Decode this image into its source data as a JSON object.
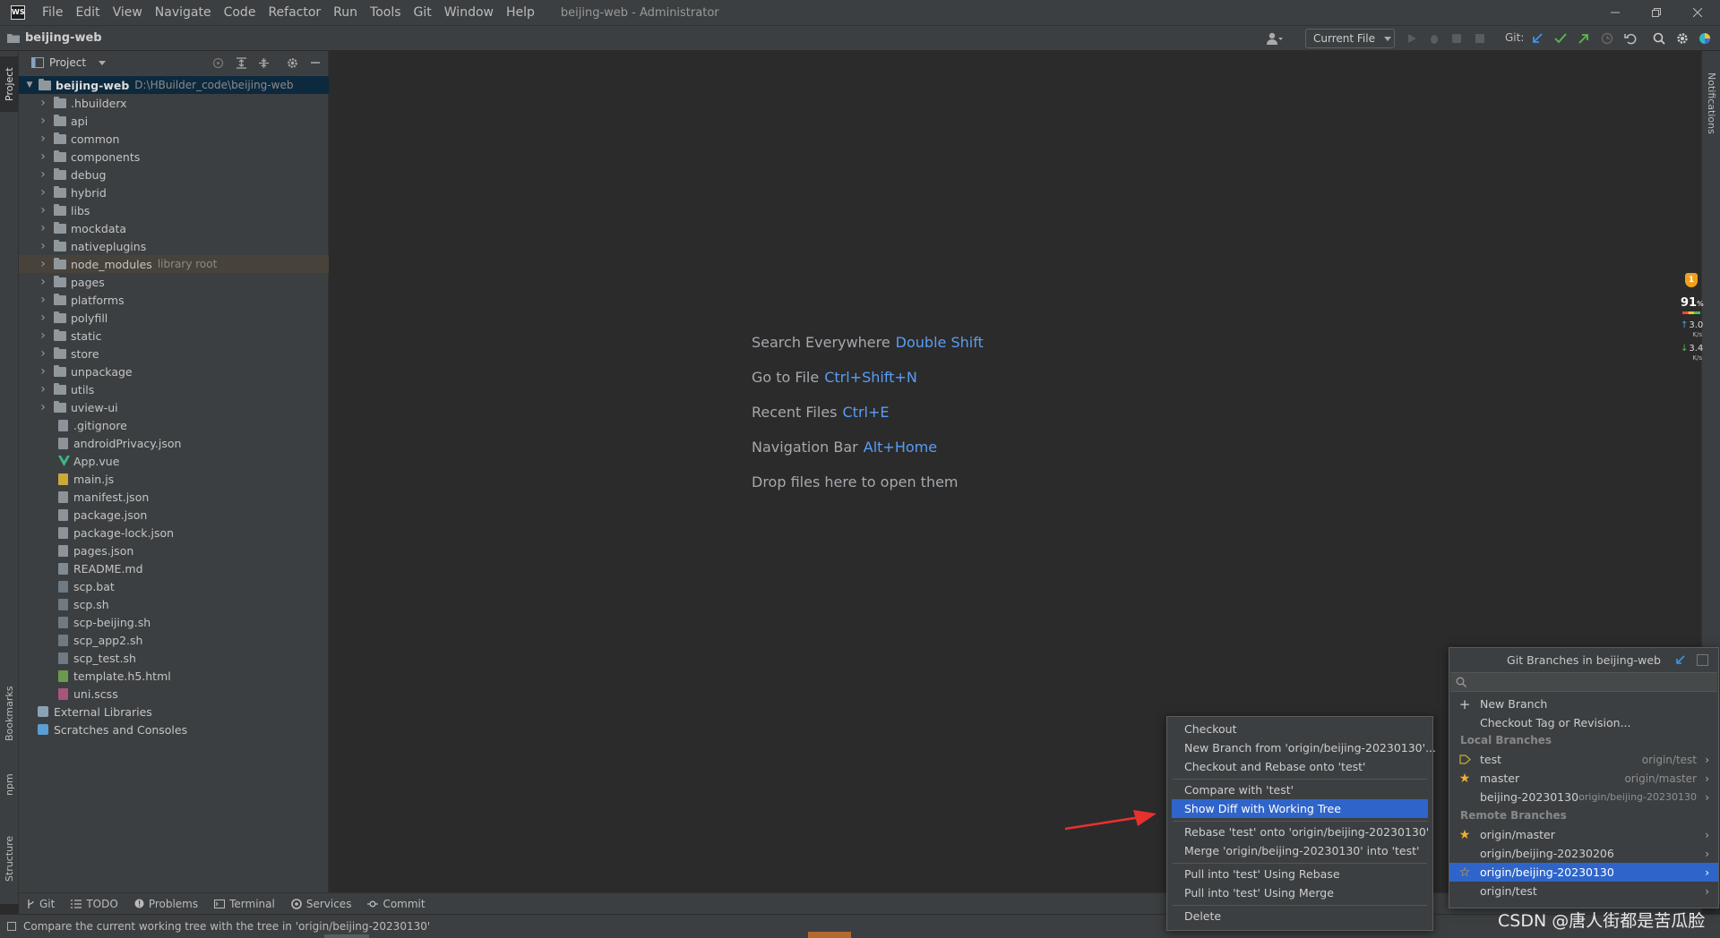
{
  "window": {
    "title": "beijing-web - Administrator",
    "app_logo": "WS",
    "menu": [
      "File",
      "Edit",
      "View",
      "Navigate",
      "Code",
      "Refactor",
      "Run",
      "Tools",
      "Git",
      "Window",
      "Help"
    ]
  },
  "navbar": {
    "breadcrumb": "beijing-web",
    "run_config": "Current File",
    "git_label": "Git:"
  },
  "side_tabs": {
    "project": "Project",
    "bookmarks": "Bookmarks",
    "npm": "npm",
    "structure": "Structure",
    "notifications": "Notifications"
  },
  "project_panel": {
    "title": "Project",
    "root": {
      "name": "beijing-web",
      "path": "D:\\HBuilder_code\\beijing-web"
    },
    "folders": [
      ".hbuilderx",
      "api",
      "common",
      "components",
      "debug",
      "hybrid",
      "libs",
      "mockdata",
      "nativeplugins",
      "node_modules",
      "pages",
      "platforms",
      "polyfill",
      "static",
      "store",
      "unpackage",
      "utils",
      "uview-ui"
    ],
    "node_modules_note": "library root",
    "files": [
      ".gitignore",
      "androidPrivacy.json",
      "App.vue",
      "main.js",
      "manifest.json",
      "package.json",
      "package-lock.json",
      "pages.json",
      "README.md",
      "scp.bat",
      "scp.sh",
      "scp-beijing.sh",
      "scp_app2.sh",
      "scp_test.sh",
      "template.h5.html",
      "uni.scss"
    ],
    "external_libraries": "External Libraries",
    "scratches": "Scratches and Consoles"
  },
  "editor_hints": [
    {
      "label": "Search Everywhere",
      "key": "Double Shift"
    },
    {
      "label": "Go to File",
      "key": "Ctrl+Shift+N"
    },
    {
      "label": "Recent Files",
      "key": "Ctrl+E"
    },
    {
      "label": "Navigation Bar",
      "key": "Alt+Home"
    },
    {
      "label": "Drop files here to open them",
      "key": ""
    }
  ],
  "bottom_tools": [
    "Git",
    "TODO",
    "Problems",
    "Terminal",
    "Services",
    "Commit"
  ],
  "status": {
    "message": "Compare the current working tree with the tree in 'origin/beijing-20230130'"
  },
  "perf": {
    "cpu": "91",
    "cpu_unit": "%",
    "up": "3.0",
    "up_unit": "K/s",
    "down": "3.4",
    "down_unit": "K/s",
    "badge": "1"
  },
  "context_menu": {
    "items": [
      "Checkout",
      "New Branch from 'origin/beijing-20230130'...",
      "Checkout and Rebase onto 'test'",
      "Compare with 'test'",
      "Show Diff with Working Tree",
      "Rebase 'test' onto 'origin/beijing-20230130'",
      "Merge 'origin/beijing-20230130' into 'test'",
      "Pull into 'test' Using Rebase",
      "Pull into 'test' Using Merge",
      "Delete"
    ],
    "selected_index": 4
  },
  "git_branches": {
    "title": "Git Branches in beijing-web",
    "search_placeholder": "",
    "actions": [
      "New Branch",
      "Checkout Tag or Revision..."
    ],
    "local_header": "Local Branches",
    "local": [
      {
        "name": "test",
        "tracking": "origin/test",
        "icon": "tag-icon"
      },
      {
        "name": "master",
        "tracking": "origin/master",
        "icon": "star-icon"
      },
      {
        "name": "beijing-20230130",
        "tracking": "origin/beijing-20230130",
        "icon": ""
      }
    ],
    "remote_header": "Remote Branches",
    "remote": [
      {
        "name": "origin/master",
        "icon": "star-icon"
      },
      {
        "name": "origin/beijing-20230206",
        "icon": ""
      },
      {
        "name": "origin/beijing-20230130",
        "icon": "star-outline-icon"
      },
      {
        "name": "origin/test",
        "icon": ""
      }
    ],
    "selected_remote_index": 2
  },
  "watermark": "CSDN @唐人街都是苦瓜脸",
  "colors": {
    "accent": "#2f65ca",
    "key_blue": "#589df6",
    "arrow_red": "#e8312f"
  }
}
